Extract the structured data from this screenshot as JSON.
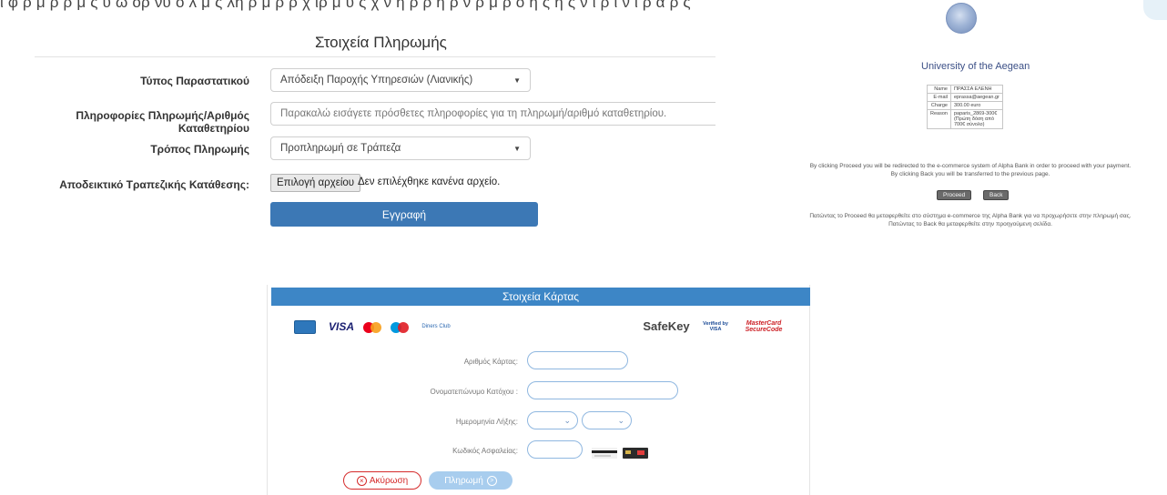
{
  "top_text": "ι φ ρ μ ρ ρ μ ς υ ώ ορ νυ ό λ μ ς λη ρ μ ρ ρ χ ιρ μ  υ ς χ ν η ρ ρ η ρ ν ρ μ  ρ ο η ς ή ς ν ί ρ ι ν ι ρ ά ρ  ς",
  "payment_form": {
    "title": "Στοιχεία Πληρωμής",
    "document_type_label": "Τύπος Παραστατικού",
    "document_type_value": "Απόδειξη Παροχής Υπηρεσιών (Λιανικής)",
    "payment_info_label": "Πληροφορίες Πληρωμής/Αριθμός Καταθετηρίου",
    "payment_info_placeholder": "Παρακαλώ εισάγετε πρόσθετες πληροφορίες για τη πληρωμή/αριθμό καταθετηρίου.",
    "payment_method_label": "Τρόπος Πληρωμής",
    "payment_method_value": "Προπληρωμή σε Τράπεζα",
    "receipt_label": "Αποδεικτικό Τραπεζικής Κατάθεσης:",
    "file_button": "Επιλογή αρχείου",
    "file_status": "Δεν επιλέχθηκε κανένα αρχείο.",
    "submit": "Εγγραφή"
  },
  "aegean": {
    "university": "University of the Aegean",
    "table": [
      {
        "key": "Name",
        "value": "ΠΡΑΣΣΑ ΕΛΕΝΗ"
      },
      {
        "key": "E-mail",
        "value": "eprassa@aegean.gr"
      },
      {
        "key": "Charge",
        "value": "300.00 euro"
      },
      {
        "key": "Reason",
        "value": "paparis_2869-300€ (Πρώτη δόση από 700€ σύνολο)"
      }
    ],
    "redirect_text_en": "By clicking Proceed you will be redirected to the e-commerce system of Alpha Bank in order to proceed with your payment.",
    "back_text_en": "By clicking Back you will be transferred to the previous page.",
    "proceed_button": "Proceed",
    "back_button": "Back",
    "redirect_text_gr": "Πατώντας το Proceed θα μεταφερθείτε στο σύστημα e-commerce της Alpha Bank για να προχωρήσετε στην πληρωμή σας.",
    "back_text_gr": "Πατώντας το Back θα μεταφερθείτε στην προηγούμενη σελίδα."
  },
  "card": {
    "header": "Στοιχεία Κάρτας",
    "logos": {
      "visa": "VISA",
      "safekey": "SafeKey",
      "verified_visa": "Verified by VISA",
      "mastercard": "MasterCard SecureCode",
      "diners": "Diners Club"
    },
    "card_number_label": "Αριθμός Κάρτας:",
    "holder_label": "Ονοματεπώνυμο Κατόχου :",
    "expiry_label": "Ημερομηνία Λήξης:",
    "cvv_label": "Κωδικός Ασφαλείας:",
    "cancel_button": "Ακύρωση",
    "pay_button": "Πληρωμή",
    "colors": {
      "header": "#3d86c6",
      "cancel": "#d52b2b",
      "pay": "#a8cdee"
    }
  }
}
